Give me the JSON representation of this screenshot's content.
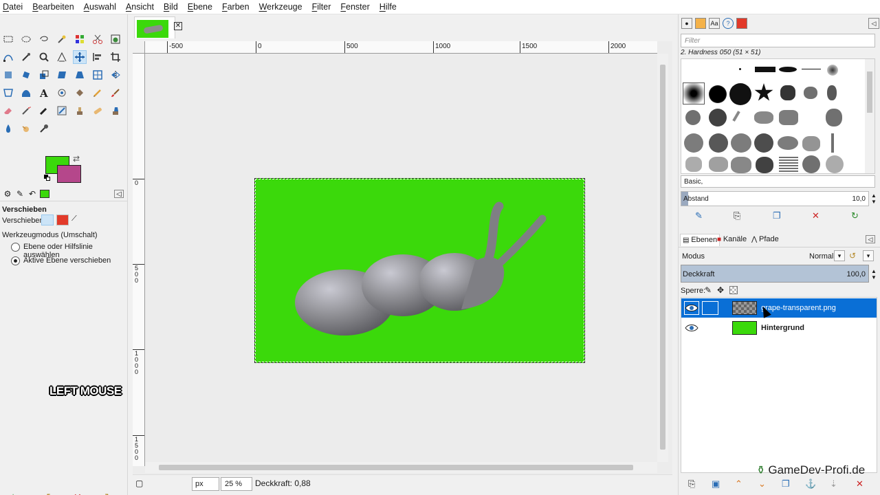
{
  "menu": [
    "Datei",
    "Bearbeiten",
    "Auswahl",
    "Ansicht",
    "Bild",
    "Ebene",
    "Farben",
    "Werkzeuge",
    "Filter",
    "Fenster",
    "Hilfe"
  ],
  "colors": {
    "foreground": "#3bd90b",
    "background": "#b5478b",
    "layer_fill": "#3bd90b",
    "selection": "#0a6fd6"
  },
  "tool_options": {
    "title": "Verschieben",
    "move_label": "Verschieben:",
    "mode_label": "Werkzeugmodus (Umschalt)",
    "option_1": "Ebene oder Hilfslinie auswählen",
    "option_2": "Aktive Ebene verschieben"
  },
  "overlay": "LEFT MOUSE",
  "ruler": {
    "top": [
      "-500",
      "0",
      "500",
      "1000",
      "1500",
      "2000"
    ],
    "left": [
      "0",
      "500",
      "1000",
      "1500"
    ]
  },
  "status": {
    "unit": "px",
    "zoom": "25 %",
    "message": "Deckkraft: 0,88"
  },
  "brushes": {
    "filter_placeholder": "Filter",
    "selected_brush": "2. Hardness 050 (51 × 51)",
    "preset": "Basic,",
    "spacing_label": "Abstand",
    "spacing_value": "10,0"
  },
  "layers_panel": {
    "tabs": [
      "Ebenen",
      "Kanäle",
      "Pfade"
    ],
    "mode_label": "Modus",
    "mode_value": "Normal",
    "opacity_label": "Deckkraft",
    "opacity_value": "100,0",
    "lock_label": "Sperre:",
    "layers": [
      {
        "name": "grape-transparent.png",
        "selected": true
      },
      {
        "name": "Hintergrund",
        "selected": false
      }
    ]
  },
  "watermark": "GameDev-Profi.de"
}
